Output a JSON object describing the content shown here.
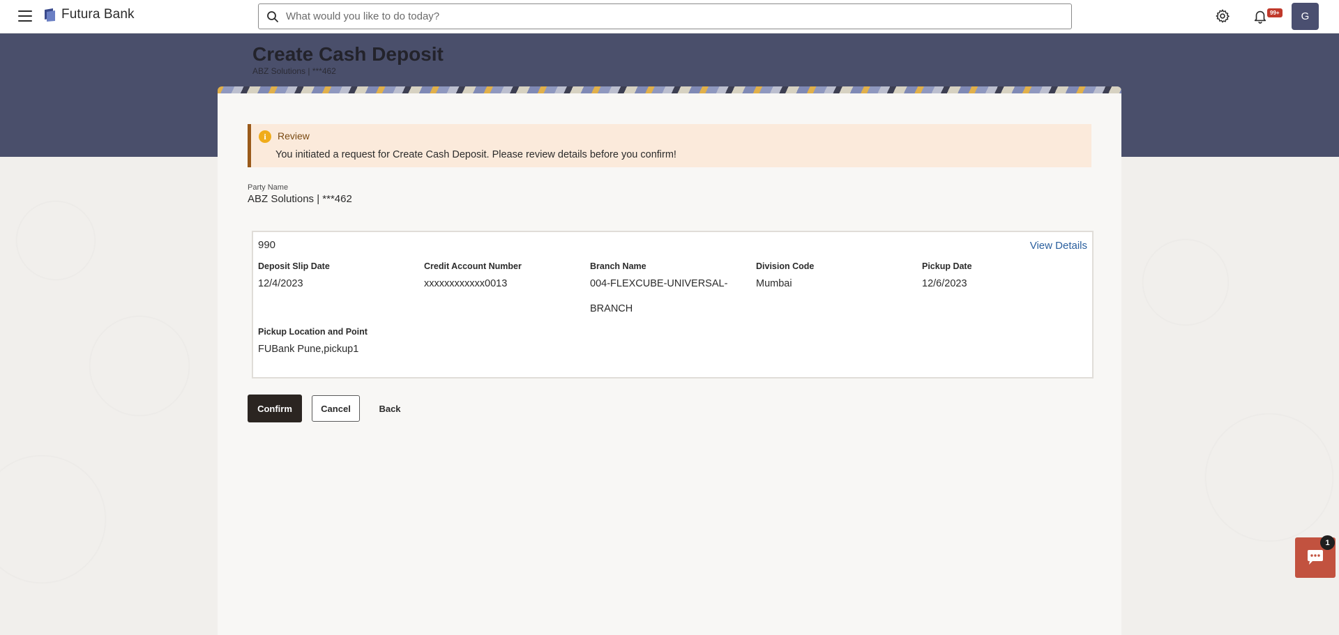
{
  "app": {
    "brand": "Futura Bank"
  },
  "search": {
    "placeholder": "What would you like to do today?"
  },
  "header": {
    "notification_badge": "99+",
    "avatar_initial": "G"
  },
  "page": {
    "title": "Create Cash Deposit",
    "subtitle": "ABZ Solutions | ***462"
  },
  "review": {
    "title": "Review",
    "message": "You initiated a request for Create Cash Deposit. Please review details before you confirm!"
  },
  "party": {
    "label": "Party Name",
    "value": "ABZ Solutions | ***462"
  },
  "deposit": {
    "slip_number": "990",
    "view_details_label": "View Details",
    "fields": [
      {
        "label": "Deposit Slip Date",
        "value": "12/4/2023"
      },
      {
        "label": "Credit Account Number",
        "value": "xxxxxxxxxxxx0013"
      },
      {
        "label": "Branch Name",
        "value": "004-FLEXCUBE-UNIVERSAL-BRANCH"
      },
      {
        "label": "Division Code",
        "value": "Mumbai"
      },
      {
        "label": "Pickup Date",
        "value": "12/6/2023"
      },
      {
        "label": "Pickup Location and Point",
        "value": "FUBank Pune,pickup1"
      }
    ]
  },
  "actions": {
    "confirm": "Confirm",
    "cancel": "Cancel",
    "back": "Back"
  },
  "chat": {
    "badge": "1"
  }
}
